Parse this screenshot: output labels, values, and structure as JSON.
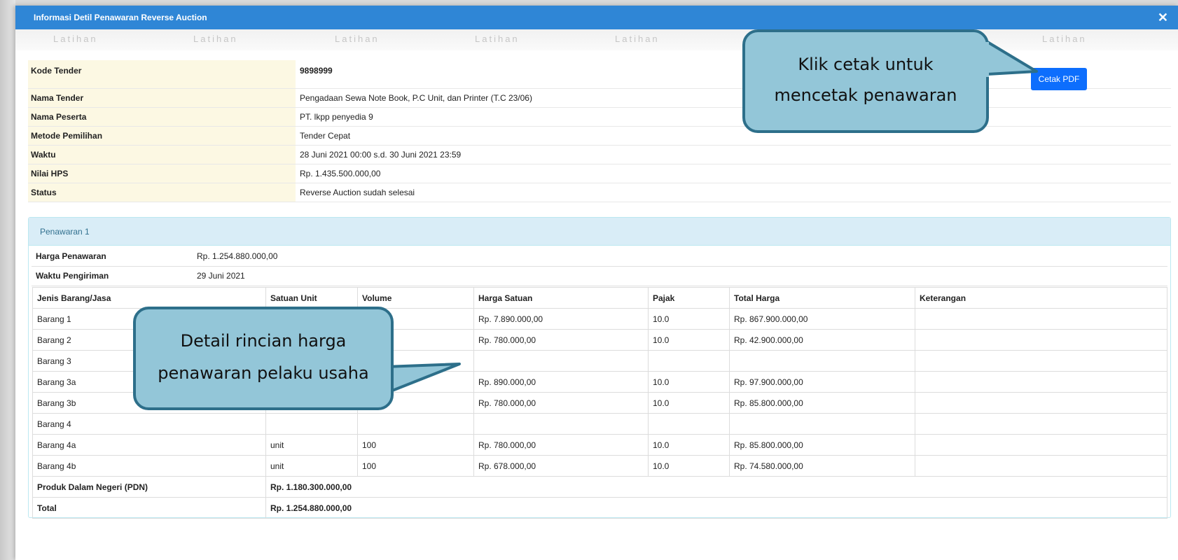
{
  "modal": {
    "title": "Informasi Detil Penawaran Reverse Auction",
    "close_icon": "close-icon"
  },
  "watermark": {
    "text": "Latihan"
  },
  "toolbar": {
    "cetak_label": "Cetak PDF"
  },
  "info": [
    {
      "label": "Kode Tender",
      "value": "9898999"
    },
    {
      "label": "Nama Tender",
      "value": "Pengadaan Sewa Note Book, P.C Unit, dan Printer (T.C 23/06)"
    },
    {
      "label": "Nama Peserta",
      "value": "PT. lkpp penyedia 9"
    },
    {
      "label": "Metode Pemilihan",
      "value": "Tender Cepat"
    },
    {
      "label": "Waktu",
      "value": "28 Juni 2021 00:00 s.d. 30 Juni 2021 23:59"
    },
    {
      "label": "Nilai HPS",
      "value": "Rp. 1.435.500.000,00"
    },
    {
      "label": "Status",
      "value": "Reverse Auction sudah selesai"
    }
  ],
  "penawaran": {
    "heading": "Penawaran 1",
    "harga_label": "Harga Penawaran",
    "harga_value": "Rp. 1.254.880.000,00",
    "waktu_label": "Waktu Pengiriman",
    "waktu_value": "29 Juni 2021",
    "columns": [
      "Jenis Barang/Jasa",
      "Satuan Unit",
      "Volume",
      "Harga Satuan",
      "Pajak",
      "Total Harga",
      "Keterangan"
    ],
    "rows": [
      [
        "Barang 1",
        "",
        "",
        "Rp. 7.890.000,00",
        "10.0",
        "Rp. 867.900.000,00",
        ""
      ],
      [
        "Barang 2",
        "",
        "",
        "Rp. 780.000,00",
        "10.0",
        "Rp. 42.900.000,00",
        ""
      ],
      [
        "Barang 3",
        "",
        "",
        "",
        "",
        "",
        ""
      ],
      [
        "Barang 3a",
        "",
        "",
        "Rp. 890.000,00",
        "10.0",
        "Rp. 97.900.000,00",
        ""
      ],
      [
        "Barang 3b",
        "",
        "",
        "Rp. 780.000,00",
        "10.0",
        "Rp. 85.800.000,00",
        ""
      ],
      [
        "Barang 4",
        "",
        "",
        "",
        "",
        "",
        ""
      ],
      [
        "Barang 4a",
        "unit",
        "100",
        "Rp. 780.000,00",
        "10.0",
        "Rp. 85.800.000,00",
        ""
      ],
      [
        "Barang 4b",
        "unit",
        "100",
        "Rp. 678.000,00",
        "10.0",
        "Rp. 74.580.000,00",
        ""
      ]
    ],
    "pdn_label": "Produk Dalam Negeri (PDN)",
    "pdn_value": "Rp. 1.180.300.000,00",
    "total_label": "Total",
    "total_value": "Rp. 1.254.880.000,00"
  },
  "callouts": {
    "cetak": [
      "Klik cetak untuk",
      "mencetak penawaran"
    ],
    "detail": [
      "Detail rincian harga",
      "penawaran pelaku usaha"
    ]
  },
  "colors": {
    "header_bg": "#2f86d6",
    "button_bg": "#0d6efd",
    "label_bg": "#fcf8e3",
    "panel_head_bg": "#d9edf7",
    "callout_fill": "#93c6d8",
    "callout_border": "#2d6f8a"
  }
}
